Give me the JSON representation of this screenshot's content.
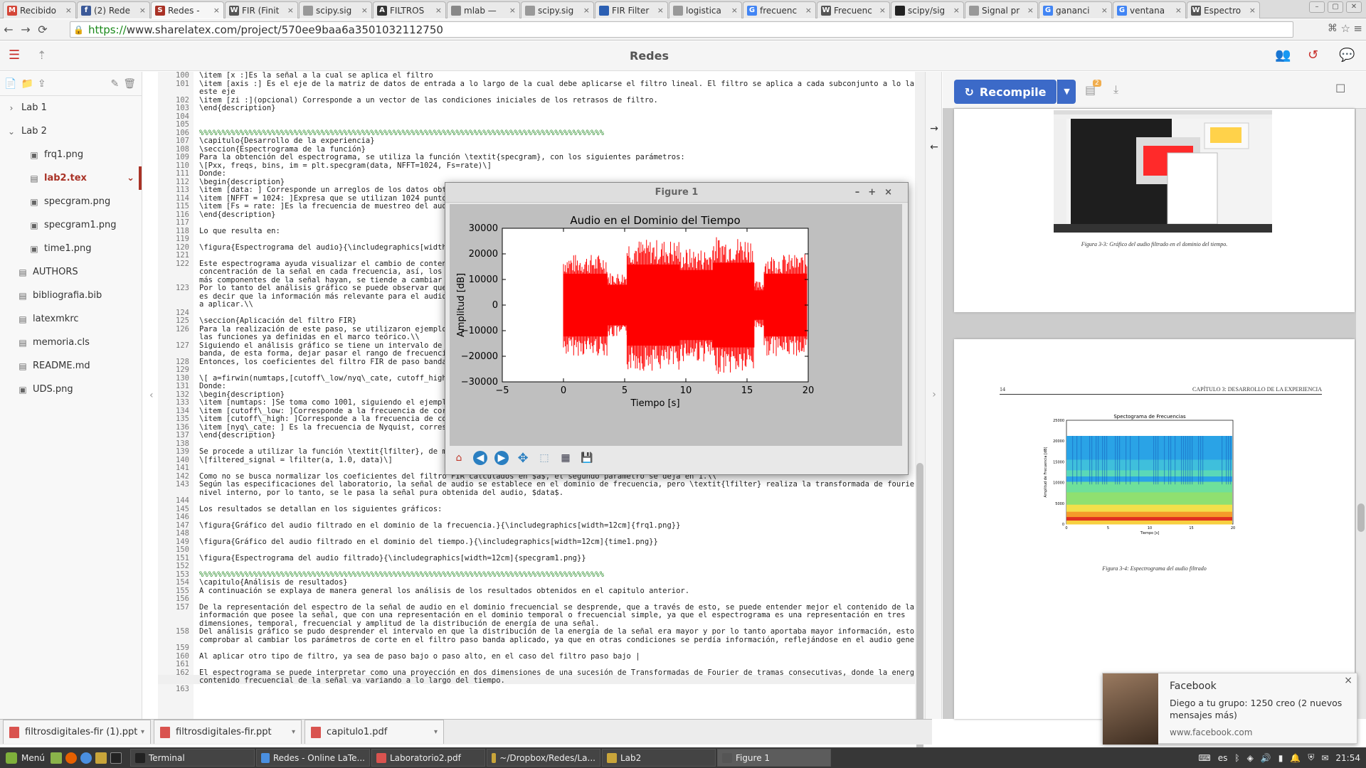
{
  "browser": {
    "tabs": [
      {
        "label": "Recibido",
        "fav": "M",
        "color": "#d44638"
      },
      {
        "label": "(2) Rede",
        "fav": "f",
        "color": "#3b5998"
      },
      {
        "label": "Redes -",
        "fav": "S",
        "color": "#a93226"
      },
      {
        "label": "FIR (Finit",
        "fav": "W",
        "color": "#555555"
      },
      {
        "label": "scipy.sig",
        "fav": "",
        "color": "#999999"
      },
      {
        "label": "FILTROS",
        "fav": "A",
        "color": "#333333"
      },
      {
        "label": "mlab —",
        "fav": "",
        "color": "#888888"
      },
      {
        "label": "scipy.sig",
        "fav": "",
        "color": "#999999"
      },
      {
        "label": "FIR Filter",
        "fav": "",
        "color": "#2b5fb3"
      },
      {
        "label": "logistica",
        "fav": "",
        "color": "#999999"
      },
      {
        "label": "frecuenc",
        "fav": "G",
        "color": "#4285f4"
      },
      {
        "label": "Frecuenc",
        "fav": "W",
        "color": "#555555"
      },
      {
        "label": "scipy/sig",
        "fav": "",
        "color": "#222222"
      },
      {
        "label": "Signal pr",
        "fav": "",
        "color": "#999999"
      },
      {
        "label": "gananci",
        "fav": "G",
        "color": "#4285f4"
      },
      {
        "label": "ventana",
        "fav": "G",
        "color": "#4285f4"
      },
      {
        "label": "Espectro",
        "fav": "W",
        "color": "#555555"
      }
    ],
    "url_scheme": "https://",
    "url_rest": "www.sharelatex.com/project/570ee9baa6a3501032112750"
  },
  "app": {
    "title": "Redes"
  },
  "filetree": [
    {
      "name": "Lab 1",
      "type": "folder-closed",
      "indent": 0
    },
    {
      "name": "Lab 2",
      "type": "folder-open",
      "indent": 0
    },
    {
      "name": "frq1.png",
      "type": "image",
      "indent": 1
    },
    {
      "name": "lab2.tex",
      "type": "file",
      "indent": 1,
      "selected": true
    },
    {
      "name": "specgram.png",
      "type": "image",
      "indent": 1
    },
    {
      "name": "specgram1.png",
      "type": "image",
      "indent": 1
    },
    {
      "name": "time1.png",
      "type": "image",
      "indent": 1
    },
    {
      "name": "AUTHORS",
      "type": "file",
      "indent": 0
    },
    {
      "name": "bibliografia.bib",
      "type": "file",
      "indent": 0
    },
    {
      "name": "latexmkrc",
      "type": "file",
      "indent": 0
    },
    {
      "name": "memoria.cls",
      "type": "file",
      "indent": 0
    },
    {
      "name": "README.md",
      "type": "file",
      "indent": 0
    },
    {
      "name": "UDS.png",
      "type": "image",
      "indent": 0
    }
  ],
  "editor": {
    "lines": [
      {
        "n": "100",
        "t": "\\item [x :]Es la señal a la cual se aplica el filtro"
      },
      {
        "n": "101",
        "t": "\\item [axis :] Es el eje de la matriz de datos de entrada a lo largo de la cual debe aplicarse el filtro lineal. El filtro se aplica a cada subconjunto a lo largo de"
      },
      {
        "n": "",
        "t": "este eje"
      },
      {
        "n": "102",
        "t": "\\item [zi :](opcional) Corresponde a un vector de las condiciones iniciales de los retrasos de filtro."
      },
      {
        "n": "103",
        "t": "\\end{description}"
      },
      {
        "n": "104",
        "t": ""
      },
      {
        "n": "105",
        "t": ""
      },
      {
        "n": "106",
        "t": "%%%%%%%%%%%%%%%%%%%%%%%%%%%%%%%%%%%%%%%%%%%%%%%%%%%%%%%%%%%%%%%%%%%%%%%%%%%%%%%%%%%%%%%%%%",
        "c": 1
      },
      {
        "n": "107",
        "t": "\\capitulo{Desarrollo de la experiencia}"
      },
      {
        "n": "108",
        "t": "\\seccion{Espectrograma de la función}"
      },
      {
        "n": "109",
        "t": "Para la obtención del espectrograma, se utiliza la función \\textit{specgram}, con los siguientes parámetros:"
      },
      {
        "n": "110",
        "t": "\\[Pxx, freqs, bins, im = plt.specgram(data, NFFT=1024, Fs=rate)\\]"
      },
      {
        "n": "111",
        "t": "Donde:"
      },
      {
        "n": "112",
        "t": "\\begin{description}"
      },
      {
        "n": "113",
        "t": "\\item [data: ] Corresponde un arreglos de los datos obten"
      },
      {
        "n": "114",
        "t": "\\item [NFFT = 1024: ]Expresa que se utilizan 1024 puntos e"
      },
      {
        "n": "115",
        "t": "\\item [Fs = rate: ]Es la frecuencia de muestreo del audio"
      },
      {
        "n": "116",
        "t": "\\end{description}"
      },
      {
        "n": "117",
        "t": ""
      },
      {
        "n": "118",
        "t": "Lo que resulta en:"
      },
      {
        "n": "119",
        "t": ""
      },
      {
        "n": "120",
        "t": "\\figura{Espectrograma del audio}{\\includegraphics[width=12"
      },
      {
        "n": "121",
        "t": ""
      },
      {
        "n": "122",
        "t": "Este espectrograma ayuda visualizar el cambio de contenid"
      },
      {
        "n": "",
        "t": "concentración de la señal en cada frecuencia, así, los co"
      },
      {
        "n": "",
        "t": "más componentes de la señal hayan, se tiende a cambiar a c"
      },
      {
        "n": "123",
        "t": "Por lo tanto del análisis gráfico se puede observar que la"
      },
      {
        "n": "",
        "t": "es decir que la información más relevante para el audio se"
      },
      {
        "n": "",
        "t": "a aplicar.\\\\"
      },
      {
        "n": "124",
        "t": ""
      },
      {
        "n": "125",
        "t": "\\seccion{Aplicación del filtro FIR}"
      },
      {
        "n": "126",
        "t": "Para la realización de este paso, se utilizaron ejemplos c"
      },
      {
        "n": "",
        "t": "las funciones ya definidas en el marco teórico.\\\\"
      },
      {
        "n": "127",
        "t": "Siguiendo el análisis gráfico se tiene un intervalo de fre"
      },
      {
        "n": "",
        "t": "banda, de esta forma, dejar pasar el rango de frecuencias"
      },
      {
        "n": "128",
        "t": "Entonces, los coeficientes del filtro FIR de paso banda se"
      },
      {
        "n": "129",
        "t": ""
      },
      {
        "n": "130",
        "t": "\\[ a=firwin(numtaps,[cutoff\\_low/nyq\\_cate, cutoff_high/ny"
      },
      {
        "n": "131",
        "t": "Donde:"
      },
      {
        "n": "132",
        "t": "\\begin{description}"
      },
      {
        "n": "133",
        "t": "\\item [numtaps: ]Se toma como 1001, siguiendo el ejemplo c"
      },
      {
        "n": "134",
        "t": "\\item [cutoff\\_low: ]Corresponde a la frecuencia de corte"
      },
      {
        "n": "135",
        "t": "\\item [cutoff\\_high: ]Corresponde a la frecuencia de corte"
      },
      {
        "n": "136",
        "t": "\\item [nyq\\_cate: ] Es la frecuencia de Nyquist, correspor"
      },
      {
        "n": "137",
        "t": "\\end{description}"
      },
      {
        "n": "138",
        "t": ""
      },
      {
        "n": "139",
        "t": "Se procede a utilizar la función \\textit{lfilter}, de mane"
      },
      {
        "n": "140",
        "t": "\\[filtered_signal = lfilter(a, 1.0, data)\\]"
      },
      {
        "n": "141",
        "t": ""
      },
      {
        "n": "142",
        "t": "Como no se busca normalizar los coeficientes del filtro FIR calculados en $a$, el segundo parámetro se deja en 1.\\\\"
      },
      {
        "n": "143",
        "t": "Según las especificaciones del laboratorio, la señal de audio se establece en el dominio de frecuencia, pero \\textit{lfilter} realiza la transformada de fourier a"
      },
      {
        "n": "",
        "t": "nivel interno, por lo tanto, se le pasa la señal pura obtenida del audio, $data$."
      },
      {
        "n": "144",
        "t": ""
      },
      {
        "n": "145",
        "t": "Los resultados se detallan en los siguientes gráficos:"
      },
      {
        "n": "146",
        "t": ""
      },
      {
        "n": "147",
        "t": "\\figura{Gráfico del audio filtrado en el dominio de la frecuencia.}{\\includegraphics[width=12cm]{frq1.png}}"
      },
      {
        "n": "148",
        "t": ""
      },
      {
        "n": "149",
        "t": "\\figura{Gráfico del audio filtrado en el dominio del tiempo.}{\\includegraphics[width=12cm]{time1.png}}"
      },
      {
        "n": "150",
        "t": ""
      },
      {
        "n": "151",
        "t": "\\figura{Espectrograma del audio filtrado}{\\includegraphics[width=12cm]{specgram1.png}}"
      },
      {
        "n": "152",
        "t": ""
      },
      {
        "n": "153",
        "t": "%%%%%%%%%%%%%%%%%%%%%%%%%%%%%%%%%%%%%%%%%%%%%%%%%%%%%%%%%%%%%%%%%%%%%%%%%%%%%%%%%%%%%%%%%%",
        "c": 1
      },
      {
        "n": "154",
        "t": "\\capitulo{Análisis de resultados}"
      },
      {
        "n": "155",
        "t": "A continuación se explaya de manera general los análisis de los resultados obtenidos en el capitulo anterior."
      },
      {
        "n": "156",
        "t": ""
      },
      {
        "n": "157",
        "t": "De la representación del espectro de la señal de audio en el dominio frecuencial se desprende, que a través de esto, se puede entender mejor el contenido de la"
      },
      {
        "n": "",
        "t": "información que posee la señal, que con una representación en el dominio temporal o frecuencial simple, ya que el espectrograma es una representación en tres"
      },
      {
        "n": "",
        "t": "dimensiones, temporal, frecuencial y amplitud de la distribución de energía de una señal."
      },
      {
        "n": "158",
        "t": "Del análisis gráfico se pudo desprender el intervalo en que la distribución de la energía de la señal era mayor y por lo tanto aportaba mayor información, esto se pudo"
      },
      {
        "n": "",
        "t": "comprobar al cambiar los parámetros de corte en el filtro paso banda aplicado, ya que en otras condiciones se perdía información, reflejándose en el audio generado."
      },
      {
        "n": "159",
        "t": ""
      },
      {
        "n": "160",
        "t": "Al aplicar otro tipo de filtro, ya sea de paso bajo o paso alto, en el caso del filtro paso bajo |"
      },
      {
        "n": "161",
        "t": ""
      },
      {
        "n": "162",
        "t": "El espectrograma se puede interpretar como una proyección en dos dimensiones de una sucesión de Transformadas de Fourier de tramas consecutivas, donde la energía y el"
      },
      {
        "n": "",
        "t": "contenido frecuencial de la señal va variando a lo largo del tiempo."
      },
      {
        "n": "163",
        "t": ""
      }
    ]
  },
  "pdf": {
    "recompile_label": "Recompile",
    "badge": "2",
    "page1_caption": "Figura 3-3: Gráfico del audio filtrado en el dominio del tiempo.",
    "page2_header_num": "14",
    "page2_header_title": "CAPÍTULO 3: DESARROLLO DE LA EXPERIENCIA",
    "spec_title": "Spectograma de Frecuencias",
    "spec_ylabel": "Amplitud de Frecuencia [dB]",
    "spec_xlabel": "Tiempo [s]",
    "spec_yticks": [
      "25000",
      "20000",
      "15000",
      "10000",
      "5000",
      "0"
    ],
    "spec_xticks": [
      "0",
      "5",
      "10",
      "15",
      "20"
    ],
    "page2_caption": "Figura 3-4: Espectrograma del audio filtrado"
  },
  "figure": {
    "window_title": "Figure 1",
    "chart_data": {
      "type": "line",
      "title": "Audio en el Dominio del Tiempo",
      "xlabel": "Tiempo [s]",
      "ylabel": "Amplitud [dB]",
      "xlim": [
        -5,
        20
      ],
      "ylim": [
        -30000,
        30000
      ],
      "xticks": [
        -5,
        0,
        5,
        10,
        15,
        20
      ],
      "yticks": [
        30000,
        20000,
        10000,
        0,
        -10000,
        -20000,
        -30000
      ],
      "ytick_labels": [
        "30000",
        "20000",
        "10000",
        "0",
        "−10000",
        "−20000",
        "−30000"
      ],
      "series_color": "#ff0000",
      "bursts": [
        {
          "x0": 0,
          "x1": 3.6,
          "amp": 17000
        },
        {
          "x0": 3.6,
          "x1": 5.2,
          "amp": 11000
        },
        {
          "x0": 5.2,
          "x1": 9.5,
          "amp": 22000
        },
        {
          "x0": 9.5,
          "x1": 12.2,
          "amp": 19000
        },
        {
          "x0": 12.2,
          "x1": 15.6,
          "amp": 23000
        },
        {
          "x0": 15.6,
          "x1": 16.4,
          "amp": 8000
        },
        {
          "x0": 16.4,
          "x1": 19.9,
          "amp": 17000
        }
      ]
    },
    "tools": [
      "home-icon",
      "back-icon",
      "forward-icon",
      "pan-icon",
      "zoom-icon",
      "configure-icon",
      "save-icon"
    ]
  },
  "bottom_tabs": [
    "filtrosdigitales-fir (1).ppt",
    "filtrosdigitales-fir.ppt",
    "capitulo1.pdf"
  ],
  "taskbar": {
    "menu_label": "Menú",
    "tasks": [
      "Terminal",
      "Redes - Online LaTe...",
      "Laboratorio2.pdf",
      "~/Dropbox/Redes/La...",
      "Lab2",
      "Figure 1"
    ],
    "lang": "es",
    "clock": "21:54"
  },
  "notification": {
    "title": "Facebook",
    "message": "Diego a tu grupo: 1250 creo (2 nuevos mensajes más)",
    "link": "www.facebook.com"
  }
}
